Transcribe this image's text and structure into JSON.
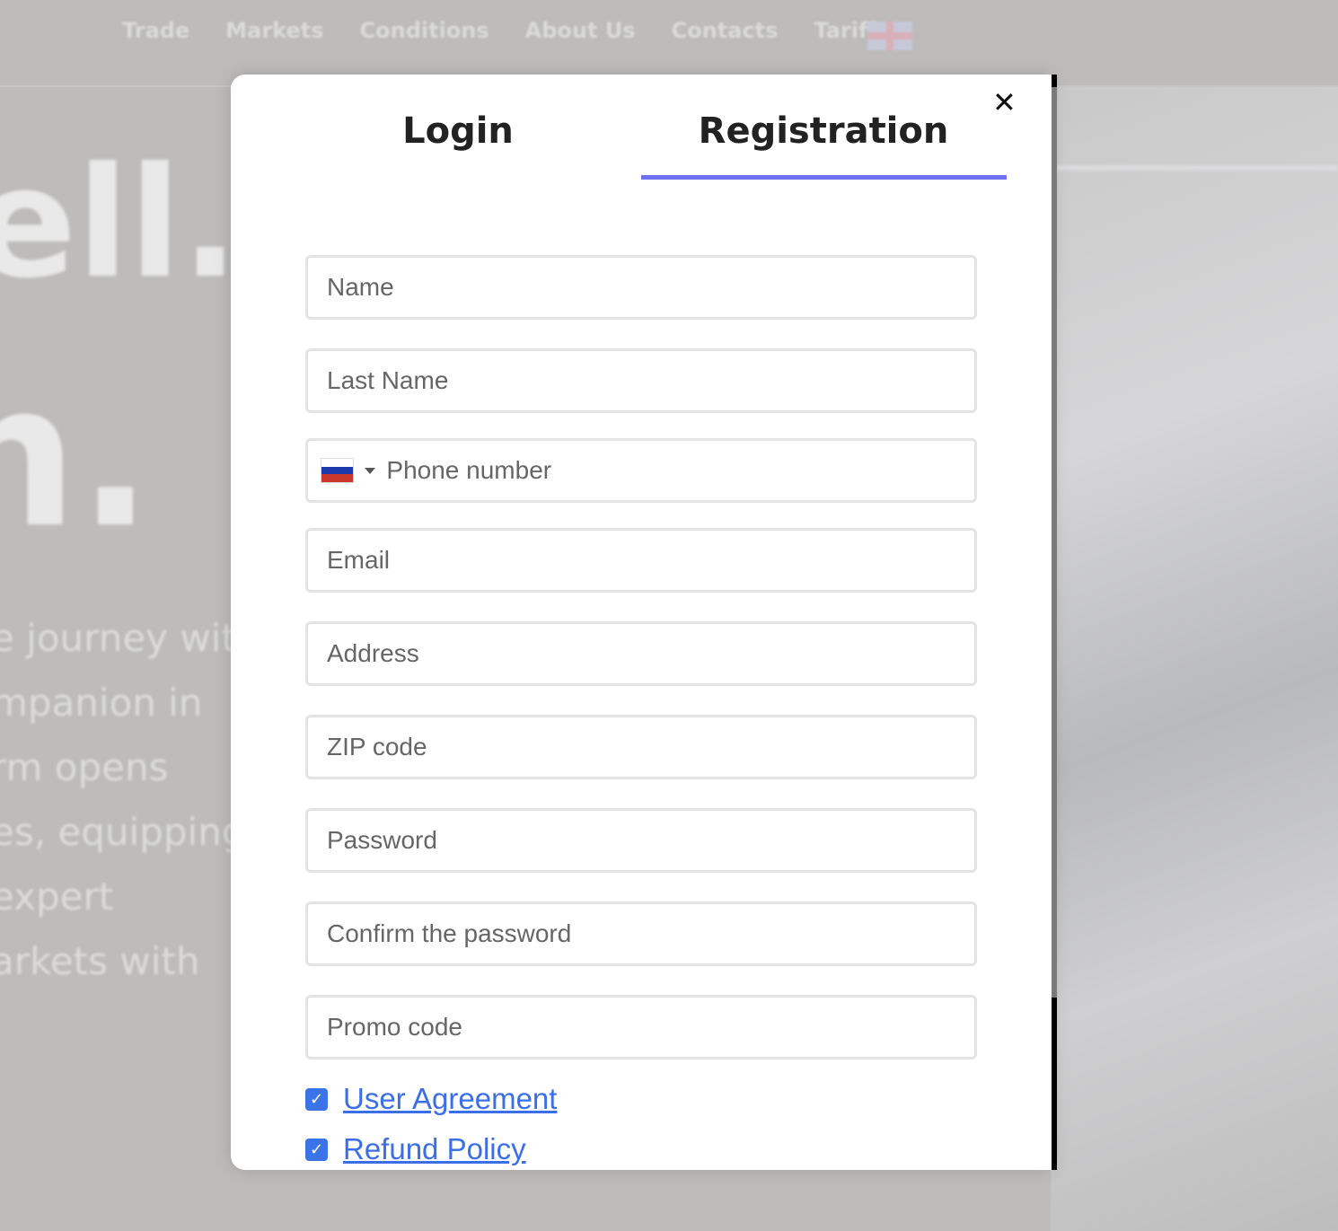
{
  "background": {
    "nav": [
      "Trade",
      "Markets",
      "Conditions",
      "About Us",
      "Contacts",
      "Tariffs"
    ],
    "language_flag": "uk-flag-icon",
    "hero_lines": [
      "ell.",
      "n."
    ],
    "paragraph": [
      "e journey with",
      "mpanion in",
      "rm opens",
      "es, equipping",
      " expert",
      "arkets with"
    ]
  },
  "modal": {
    "close": "✕",
    "tabs": [
      {
        "label": "Login",
        "active": false
      },
      {
        "label": "Registration",
        "active": true
      }
    ],
    "accent": "#6d72f5",
    "fields": {
      "name": "Name",
      "last_name": "Last Name",
      "phone": "Phone number",
      "email": "Email",
      "address": "Address",
      "zip": "ZIP code",
      "password": "Password",
      "confirm": "Confirm the password",
      "promo": "Promo code"
    },
    "phone_country": "ru-flag-icon",
    "checks": [
      {
        "label": "User Agreement",
        "checked": true
      },
      {
        "label": "Refund Policy",
        "checked": true
      }
    ],
    "check_mark": "✓"
  }
}
